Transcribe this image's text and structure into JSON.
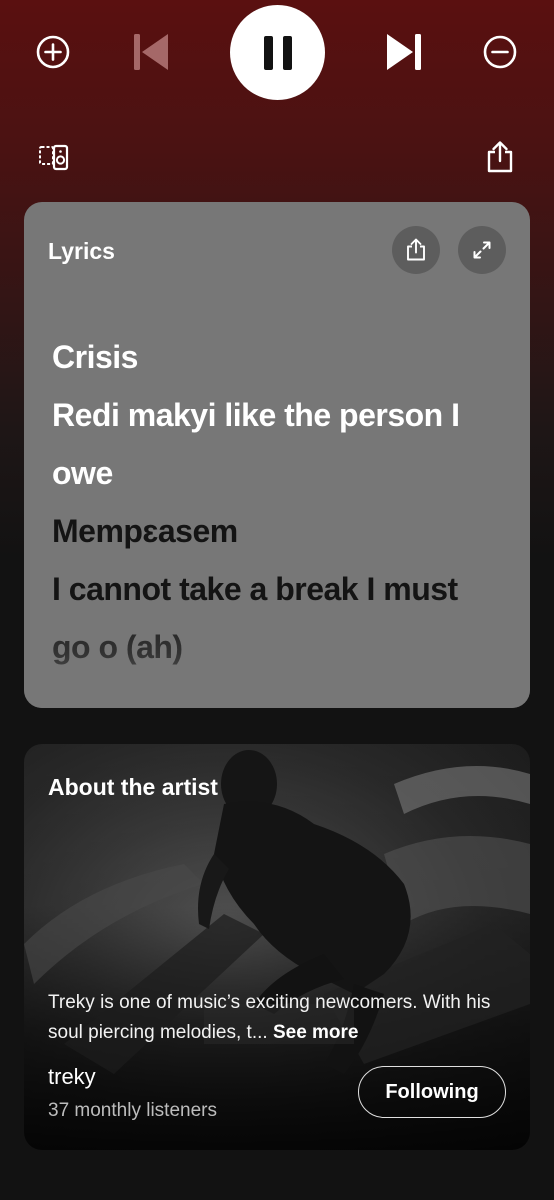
{
  "player": {
    "add_icon": "plus-circle-icon",
    "previous_icon": "skip-previous-icon",
    "pause_icon": "pause-icon",
    "next_icon": "skip-next-icon",
    "remove_icon": "minus-circle-icon",
    "devices_icon": "devices-icon",
    "share_icon": "share-icon"
  },
  "lyrics": {
    "title": "Lyrics",
    "lines": [
      {
        "text": "Crisis",
        "state": "sung"
      },
      {
        "text": "Redi makyi like the person I",
        "state": "sung"
      },
      {
        "text": "owe",
        "state": "sung"
      },
      {
        "text": "Mempɛasem",
        "state": "upcoming"
      },
      {
        "text": "I cannot take a break I must",
        "state": "upcoming"
      },
      {
        "text": "go o (ah)",
        "state": "upcoming"
      }
    ]
  },
  "artist": {
    "heading": "About the artist",
    "bio": "Treky is one of music’s exciting newcomers. With his soul piercing melodies, t...",
    "see_more": "See more",
    "name": "treky",
    "listeners": "37 monthly listeners",
    "follow_label": "Following"
  },
  "colors": {
    "top_gradient": "#5a1010",
    "background": "#121212",
    "lyrics_card": "#777777",
    "sung_text": "#ffffff",
    "upcoming_text": "#141414"
  }
}
